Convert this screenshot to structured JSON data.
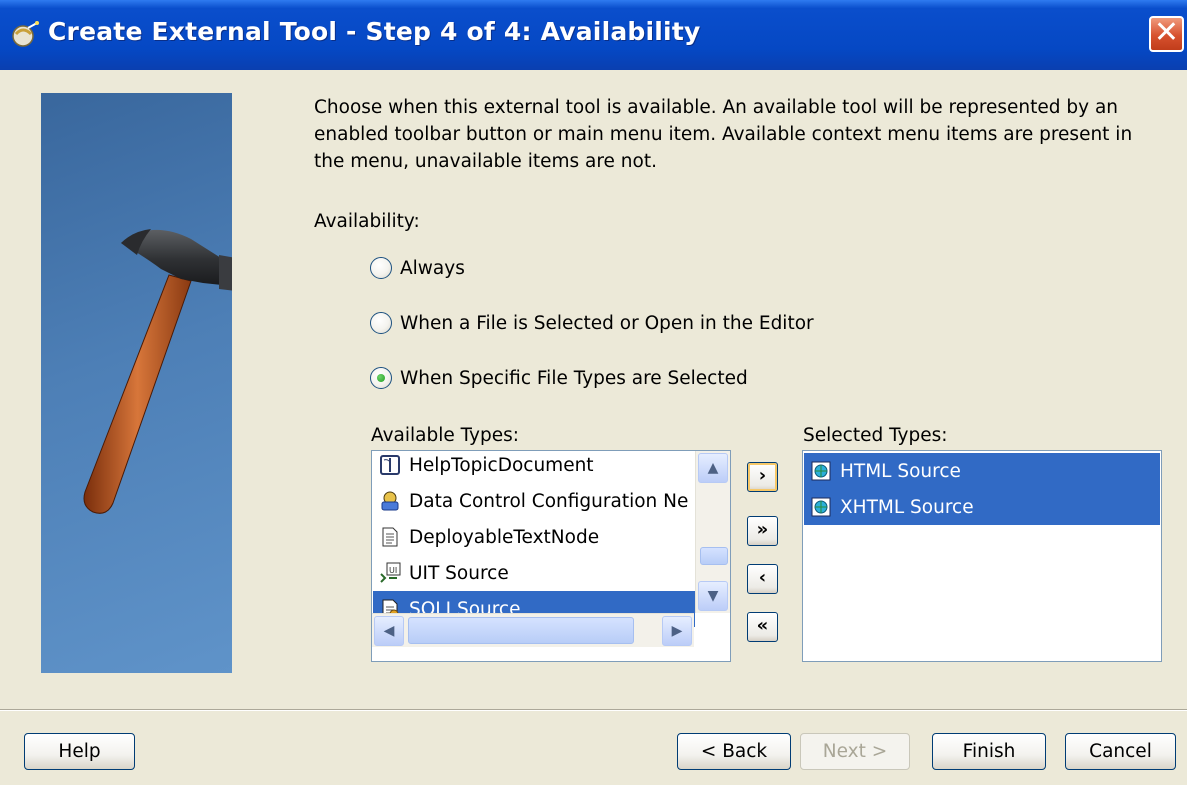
{
  "window": {
    "title": "Create External Tool - Step 4 of 4: Availability",
    "close_label": "✕"
  },
  "intro": {
    "description": "Choose when this external tool is available. An available tool will be represented by an enabled toolbar button or main menu item. Available context menu items are present in the menu, unavailable items are not."
  },
  "availability": {
    "label": "Availability:",
    "options": [
      {
        "label": "Always",
        "checked": false
      },
      {
        "label": "When a File is Selected or Open in the Editor",
        "checked": false
      },
      {
        "label": "When Specific File Types are Selected",
        "checked": true
      }
    ]
  },
  "available_types": {
    "label": "Available Types:",
    "items": [
      {
        "label": "HelpTopicDocument",
        "icon": "help-topic-icon",
        "selected": false
      },
      {
        "label": "Data Control Configuration Ne",
        "icon": "data-control-icon",
        "selected": false
      },
      {
        "label": "DeployableTextNode",
        "icon": "text-document-icon",
        "selected": false
      },
      {
        "label": "UIT Source",
        "icon": "uit-source-icon",
        "selected": false
      },
      {
        "label": "SQLJ Source",
        "icon": "sqlj-source-icon",
        "selected": true
      }
    ]
  },
  "selected_types": {
    "label": "Selected Types:",
    "items": [
      {
        "label": "HTML Source",
        "icon": "html-source-icon",
        "selected": true
      },
      {
        "label": "XHTML Source",
        "icon": "xhtml-source-icon",
        "selected": true
      }
    ]
  },
  "move_buttons": {
    "add": "›",
    "add_all": "»",
    "remove": "‹",
    "remove_all": "«"
  },
  "footer": {
    "help": "Help",
    "back": "< Back",
    "next": "Next >",
    "finish": "Finish",
    "cancel": "Cancel"
  },
  "colors": {
    "title_bar": "#0548c4",
    "selection": "#316ac5",
    "dialog_bg": "#ece9d8"
  }
}
